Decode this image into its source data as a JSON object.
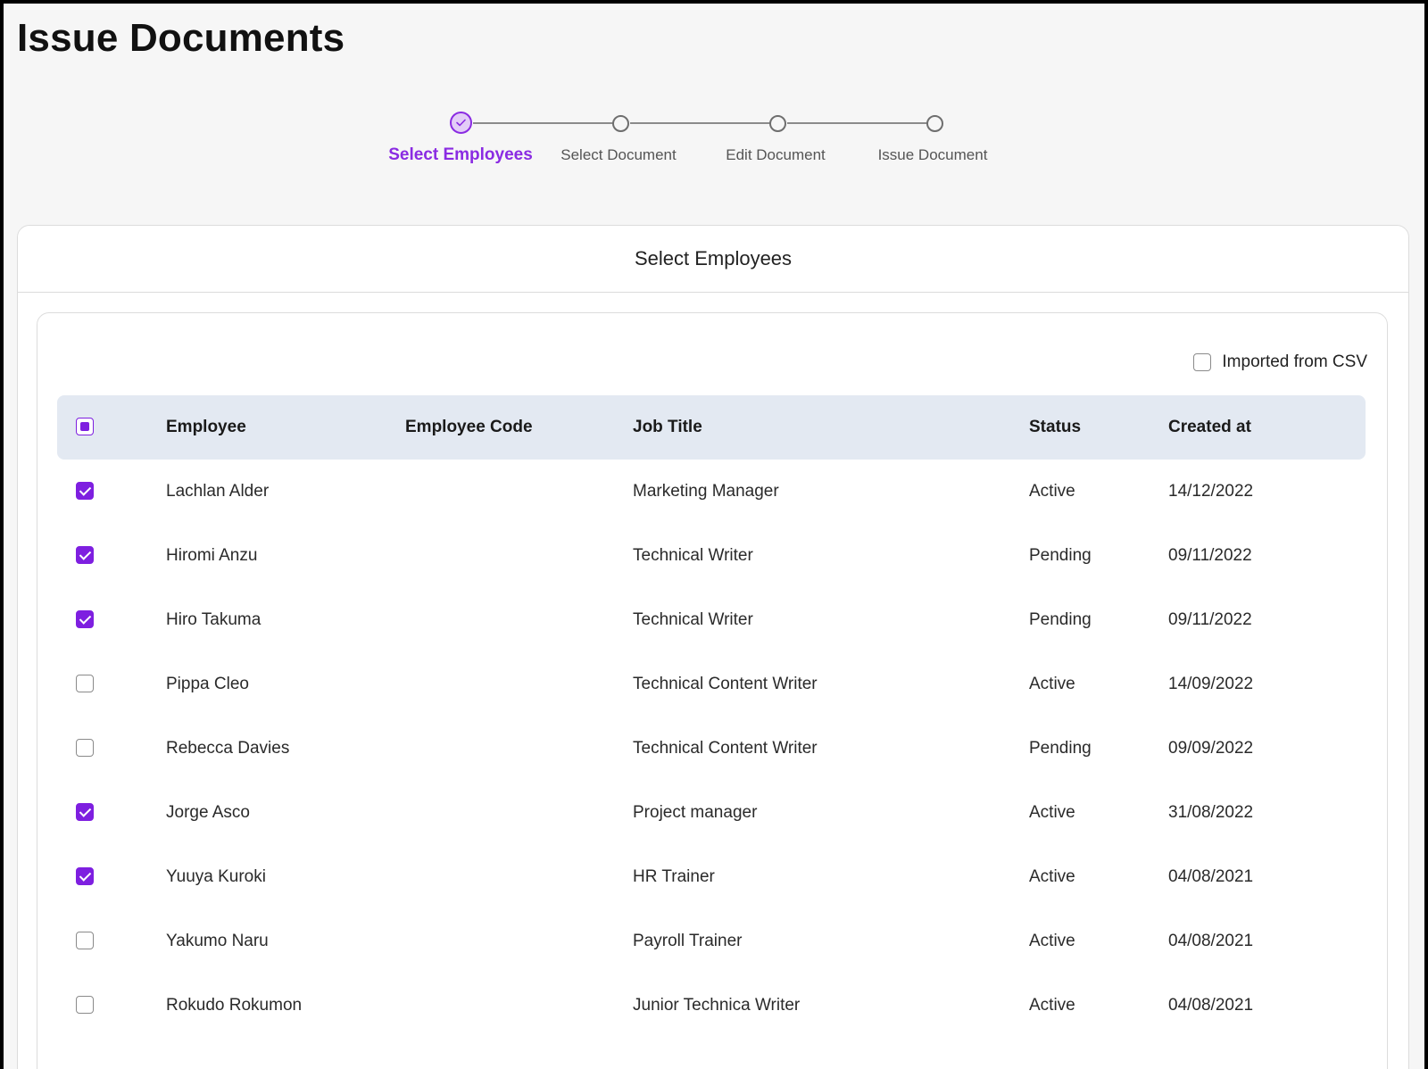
{
  "page": {
    "title": "Issue Documents"
  },
  "stepper": {
    "steps": [
      {
        "label": "Select Employees",
        "state": "active"
      },
      {
        "label": "Select Document",
        "state": "pending"
      },
      {
        "label": "Edit Document",
        "state": "pending"
      },
      {
        "label": "Issue Document",
        "state": "pending"
      }
    ],
    "active_color": "#8a2be2"
  },
  "panel": {
    "title": "Select Employees"
  },
  "filters": {
    "imported_from_csv_label": "Imported from CSV",
    "imported_from_csv_checked": false
  },
  "table": {
    "select_all_state": "indeterminate",
    "headers": {
      "employee": "Employee",
      "employee_code": "Employee Code",
      "job_title": "Job Title",
      "status": "Status",
      "created_at": "Created at"
    },
    "rows": [
      {
        "selected": true,
        "employee": "Lachlan Alder",
        "employee_code": "",
        "job_title": "Marketing Manager",
        "status": "Active",
        "created_at": "14/12/2022"
      },
      {
        "selected": true,
        "employee": "Hiromi Anzu",
        "employee_code": "",
        "job_title": "Technical Writer",
        "status": "Pending",
        "created_at": "09/11/2022"
      },
      {
        "selected": true,
        "employee": "Hiro Takuma",
        "employee_code": "",
        "job_title": "Technical Writer",
        "status": "Pending",
        "created_at": "09/11/2022"
      },
      {
        "selected": false,
        "employee": "Pippa Cleo",
        "employee_code": "",
        "job_title": "Technical Content Writer",
        "status": "Active",
        "created_at": "14/09/2022"
      },
      {
        "selected": false,
        "employee": "Rebecca Davies",
        "employee_code": "",
        "job_title": "Technical Content Writer",
        "status": "Pending",
        "created_at": "09/09/2022"
      },
      {
        "selected": true,
        "employee": "Jorge Asco",
        "employee_code": "",
        "job_title": "Project manager",
        "status": "Active",
        "created_at": "31/08/2022"
      },
      {
        "selected": true,
        "employee": "Yuuya Kuroki",
        "employee_code": "",
        "job_title": "HR Trainer",
        "status": "Active",
        "created_at": "04/08/2021"
      },
      {
        "selected": false,
        "employee": "Yakumo Naru",
        "employee_code": "",
        "job_title": "Payroll Trainer",
        "status": "Active",
        "created_at": "04/08/2021"
      },
      {
        "selected": false,
        "employee": "Rokudo Rokumon",
        "employee_code": "",
        "job_title": "Junior Technica Writer",
        "status": "Active",
        "created_at": "04/08/2021"
      }
    ]
  }
}
